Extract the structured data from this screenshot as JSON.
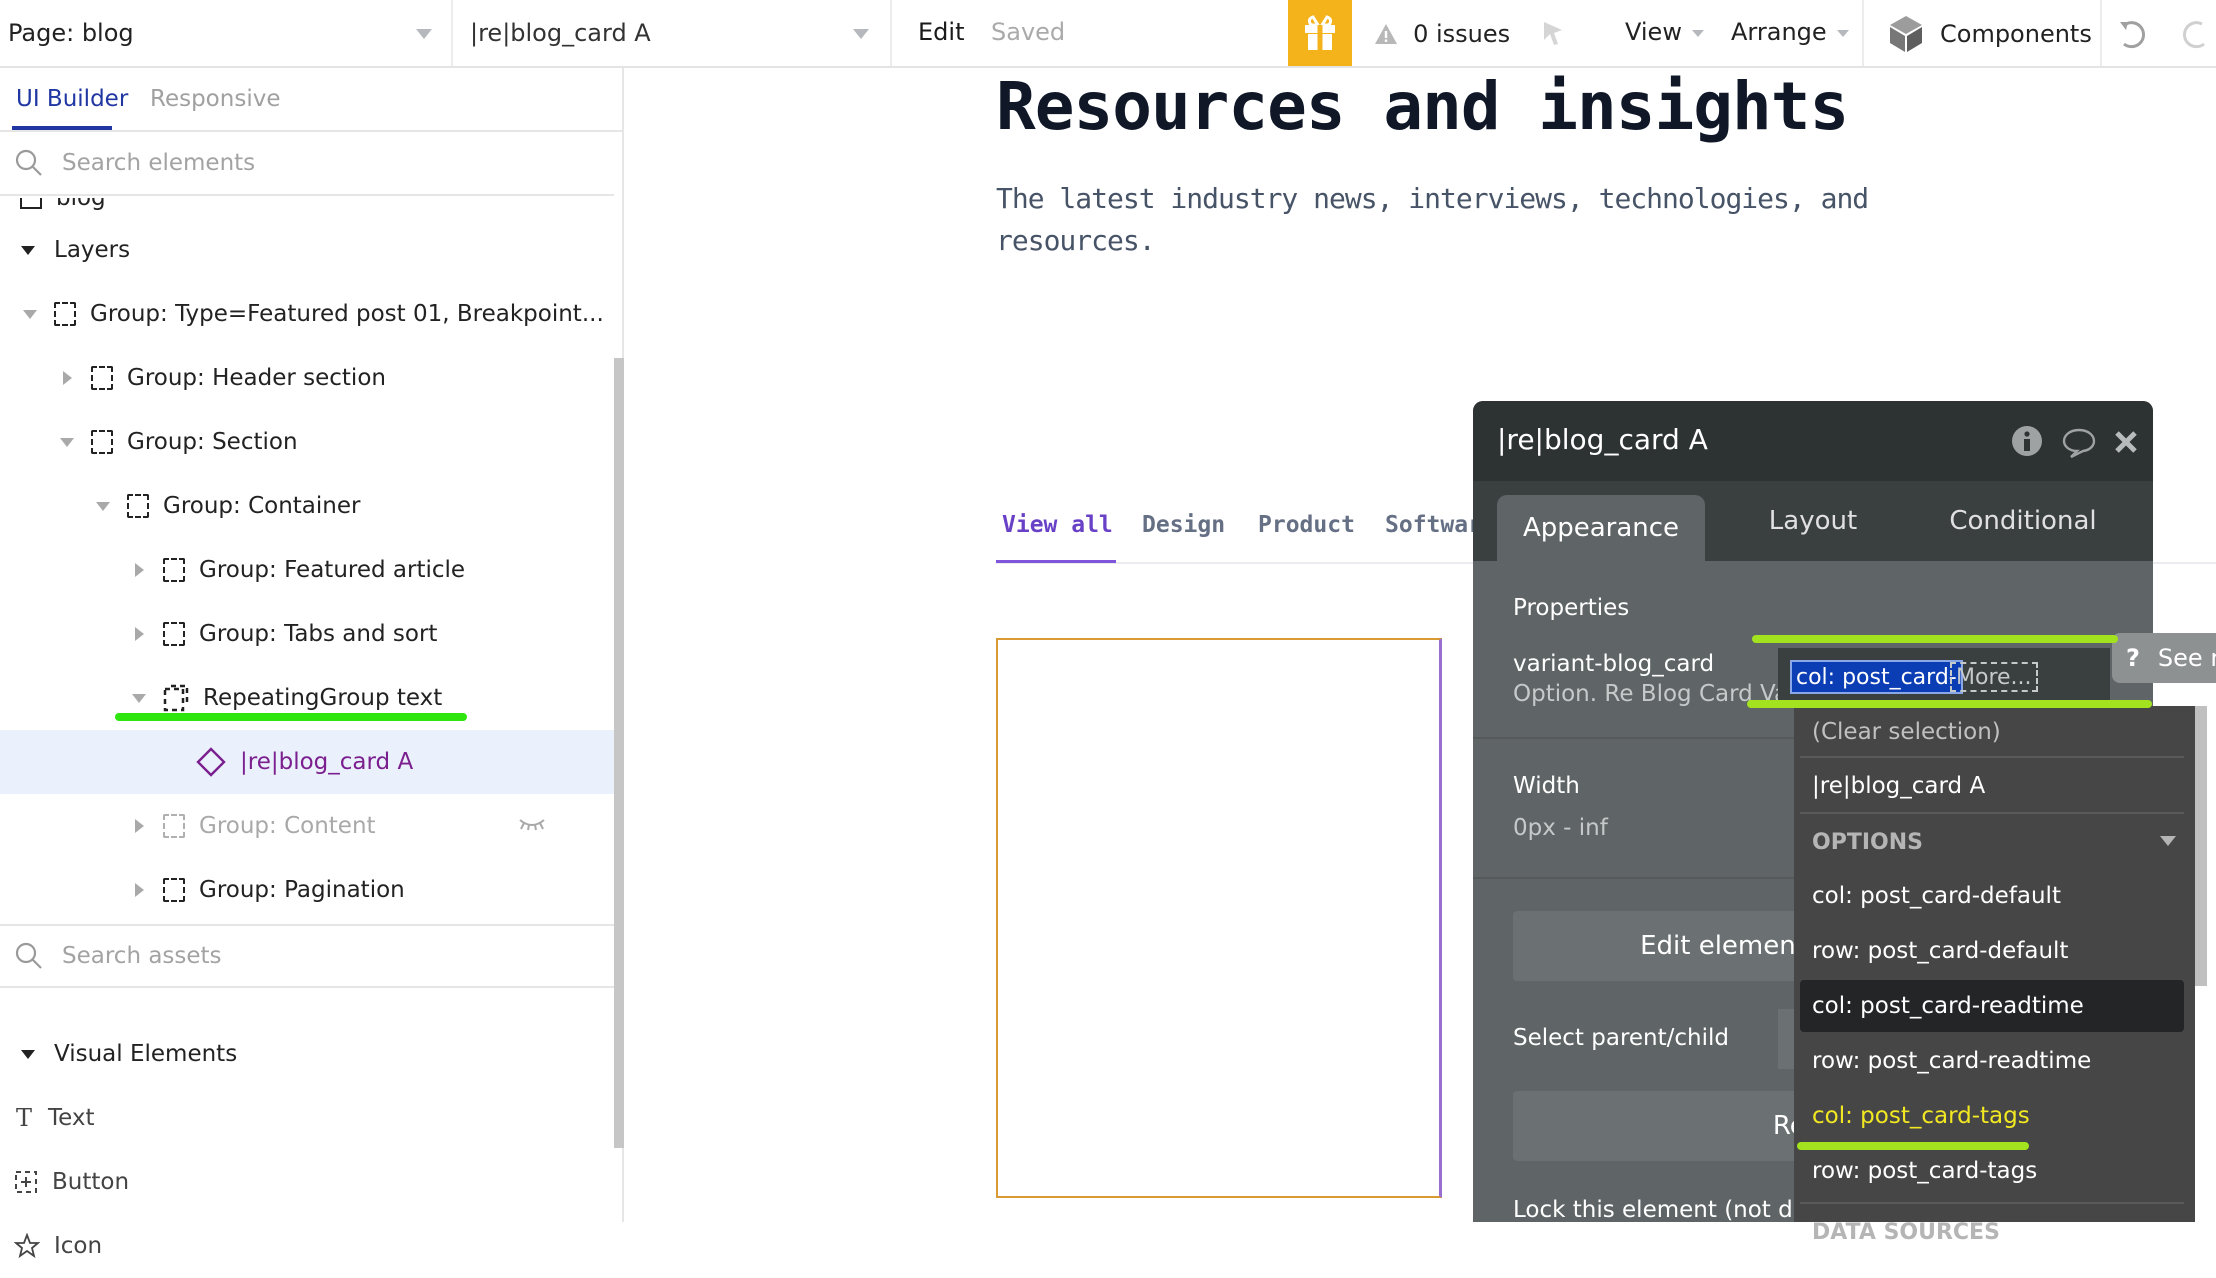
{
  "topbar": {
    "page_selector": "Page: blog",
    "element_selector": "|re|blog_card A",
    "edit_label": "Edit",
    "save_status": "Saved",
    "issues": "0 issues",
    "view_menu": "View",
    "arrange_menu": "Arrange",
    "components": "Components",
    "accent_color": "#f5b31b"
  },
  "left_panel": {
    "tabs": [
      {
        "label": "UI Builder",
        "active": true
      },
      {
        "label": "Responsive",
        "active": false
      }
    ],
    "search_elements_placeholder": "Search elements",
    "partial_row": "blog",
    "layers_header": "Layers",
    "tree": [
      {
        "label": "Group: Type=Featured post 01, Breakpoint...",
        "level": 0,
        "expanded": true
      },
      {
        "label": "Group: Header section",
        "level": 1,
        "expanded": false
      },
      {
        "label": "Group: Section",
        "level": 1,
        "expanded": true
      },
      {
        "label": "Group: Container",
        "level": 2,
        "expanded": true
      },
      {
        "label": "Group: Featured article",
        "level": 3,
        "expanded": false
      },
      {
        "label": "Group: Tabs and sort",
        "level": 3,
        "expanded": false
      },
      {
        "label": "RepeatingGroup text",
        "level": 3,
        "expanded": true
      },
      {
        "label": "|re|blog_card A",
        "level": 4,
        "selected": true
      },
      {
        "label": "Group: Content",
        "level": 3,
        "expanded": false,
        "hidden": true
      },
      {
        "label": "Group: Pagination",
        "level": 3,
        "expanded": false
      }
    ],
    "search_assets_placeholder": "Search assets",
    "visual_elements_header": "Visual Elements",
    "assets": [
      "Text",
      "Button",
      "Icon"
    ]
  },
  "canvas": {
    "heading": "Resources and insights",
    "subheading": "The latest industry news, interviews, technologies, and resources.",
    "category_tabs": [
      "View all",
      "Design",
      "Product",
      "Softwar"
    ],
    "active_category": "View all"
  },
  "editor": {
    "title": "|re|blog_card A",
    "tabs": [
      "Appearance",
      "Layout",
      "Conditional"
    ],
    "active_tab": "Appearance",
    "properties_label": "Properties",
    "variant_label": "variant-blog_card",
    "variant_type": "Option. Re Blog Card Variants",
    "variant_value": "col: post_card-",
    "more_label": "More...",
    "width_label": "Width",
    "width_value": "0px - inf",
    "edit_element_button": "Edit element",
    "select_parent_child_label": "Select parent/child",
    "reveal_button": "Reveal in the",
    "lock_label": "Lock this element (not dr",
    "see_reference": "See r"
  },
  "dropdown": {
    "clear_selection": "(Clear selection)",
    "current_element": "|re|blog_card A",
    "options_header": "OPTIONS",
    "options": [
      {
        "label": "col: post_card-default"
      },
      {
        "label": "row: post_card-default"
      },
      {
        "label": "col: post_card-readtime",
        "hovered": true
      },
      {
        "label": "row: post_card-readtime"
      },
      {
        "label": "col: post_card-tags",
        "highlighted": true
      },
      {
        "label": "row: post_card-tags"
      }
    ],
    "data_sources_header": "DATA SOURCES"
  }
}
